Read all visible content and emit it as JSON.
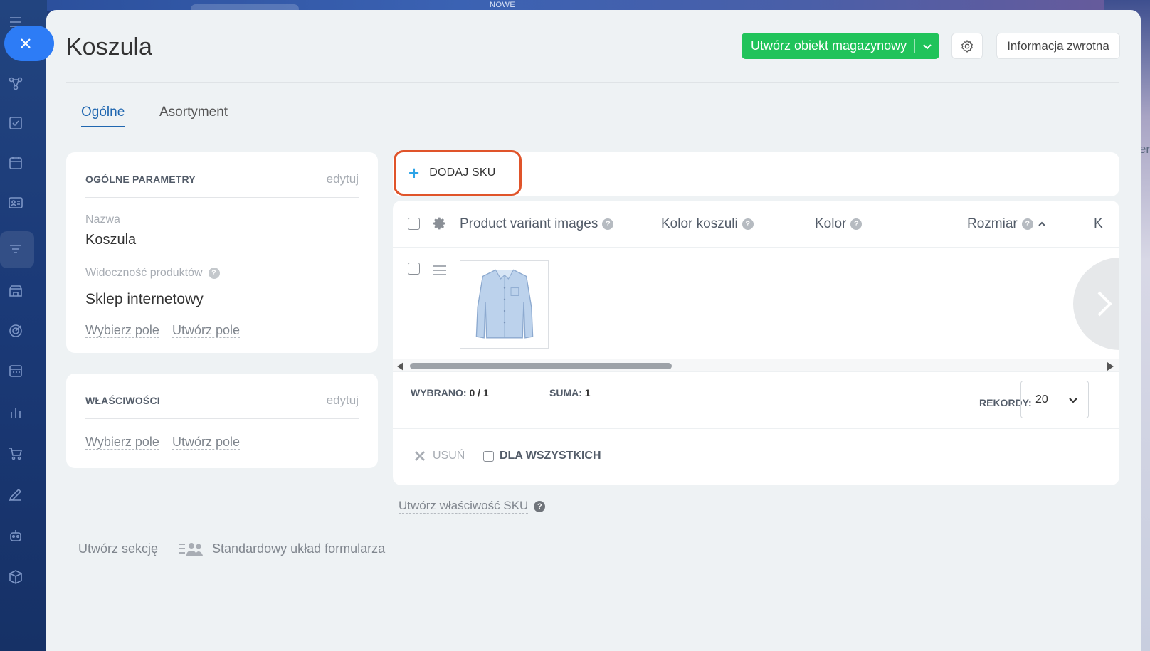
{
  "background": {
    "top_label": "NOWE",
    "right_fragment": "er"
  },
  "rail": {
    "close_icon": "close-icon",
    "icons": [
      "flow-icon",
      "task-check-icon",
      "calendar-icon",
      "contact-card-icon",
      "filter-funnel-icon",
      "store-icon",
      "target-icon",
      "schedule-icon",
      "analytics-icon",
      "cart-icon",
      "sign-icon",
      "robot-icon",
      "cube-icon"
    ]
  },
  "header": {
    "title": "Koszula",
    "primary_button": "Utwórz obiekt magazynowy",
    "feedback_button": "Informacja zwrotna"
  },
  "tabs": [
    {
      "label": "Ogólne",
      "active": true
    },
    {
      "label": "Asortyment",
      "active": false
    }
  ],
  "general_card": {
    "title": "OGÓLNE PARAMETRY",
    "edit": "edytuj",
    "name_label": "Nazwa",
    "name_value": "Koszula",
    "visibility_label": "Widoczność produktów",
    "visibility_value": "Sklep internetowy",
    "select_field": "Wybierz pole",
    "create_field": "Utwórz pole"
  },
  "properties_card": {
    "title": "WŁAŚCIWOŚCI",
    "edit": "edytuj",
    "select_field": "Wybierz pole",
    "create_field": "Utwórz pole"
  },
  "sku": {
    "add_button": "DODAJ SKU",
    "columns": [
      "Product variant images",
      "Kolor koszuli",
      "Kolor",
      "Rozmiar",
      "K"
    ],
    "selected_label": "WYBRANO:",
    "selected_value": "0 / 1",
    "total_label": "SUMA:",
    "total_value": "1",
    "records_label": "REKORDY:",
    "records_value": "20",
    "delete_label": "USUŃ",
    "for_all_label": "DLA WSZYSTKICH",
    "create_property": "Utwórz właściwość SKU"
  },
  "footer": {
    "create_section": "Utwórz sekcję",
    "standard_layout": "Standardowy układ formularza"
  },
  "colors": {
    "primary_green": "#20c35a",
    "accent_blue": "#2067b0",
    "highlight_orange": "#e0542a",
    "close_blue": "#2d7cf6"
  }
}
